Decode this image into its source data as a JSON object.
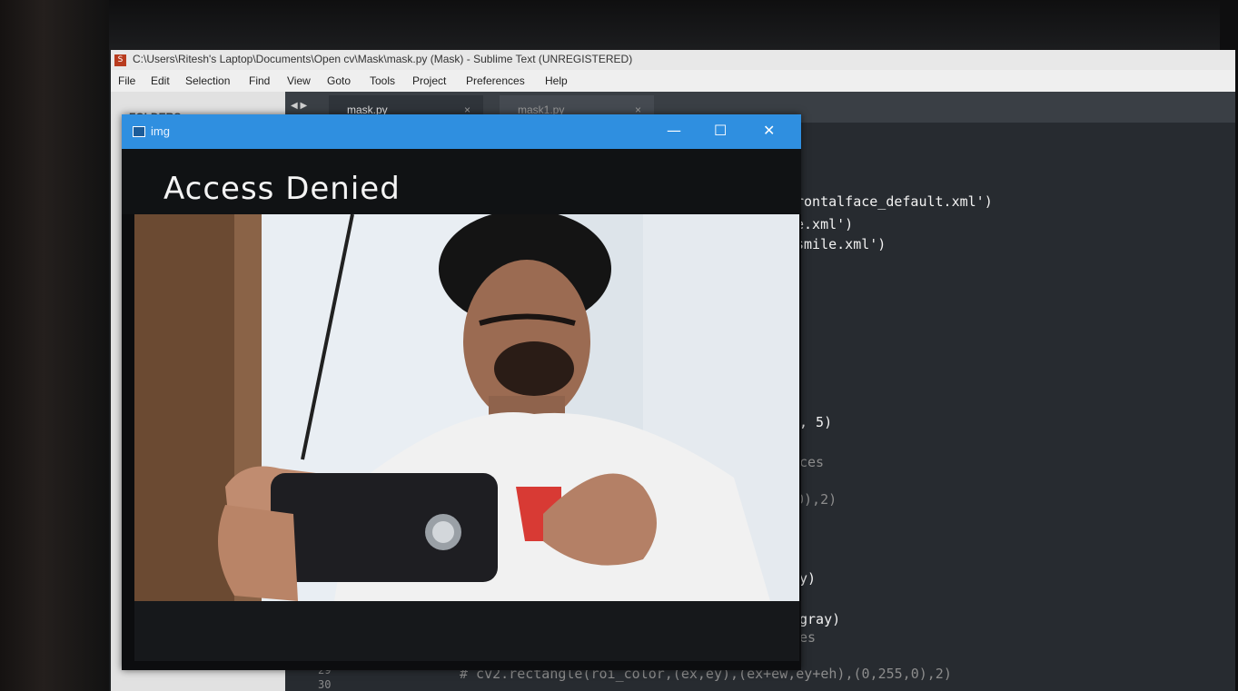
{
  "window": {
    "title": "C:\\Users\\Ritesh's Laptop\\Documents\\Open cv\\Mask\\mask.py (Mask) - Sublime Text (UNREGISTERED)",
    "app_icon_glyph": "S"
  },
  "menu": [
    "File",
    "Edit",
    "Selection",
    "Find",
    "View",
    "Goto",
    "Tools",
    "Project",
    "Preferences",
    "Help"
  ],
  "sidebar": {
    "folders_label": "FOLDERS"
  },
  "tabs": {
    "arrows": "◀ ▶",
    "items": [
      {
        "label": "mask.py",
        "close": "×",
        "active": true
      },
      {
        "label": "mask1.py",
        "close": "×",
        "active": false
      }
    ]
  },
  "code_fragments": [
    "rontalface_default.xml')",
    "e.xml')",
    "smile.xml')",
    ", 5)",
    "ces",
    "0),2)",
    "y)",
    "gray)",
    "es",
    "# cv2.rectangle(roi_color,(ex,ey),(ex+ew,ey+eh),(0,255,0),2)"
  ],
  "line_numbers": [
    "29",
    "30"
  ],
  "cv_window": {
    "title": "img",
    "minimize": "—",
    "maximize": "☐",
    "close": "✕",
    "overlay_text": "Access Denied"
  },
  "colors": {
    "cv_titlebar": "#2f8fe0",
    "editor_bg": "#272b30",
    "overlay_text": "#f4f4f4"
  }
}
